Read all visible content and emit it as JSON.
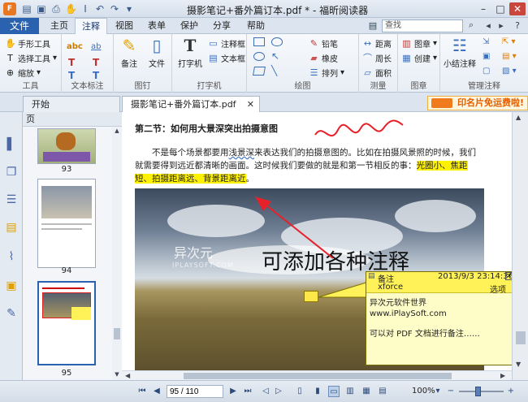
{
  "window": {
    "title": "摄影笔记+番外篇订本.pdf * - 福昕阅读器",
    "minimize": "–",
    "maximize": "□",
    "close": "✕"
  },
  "menu": {
    "file": "文件",
    "tabs": [
      "主页",
      "注释",
      "视图",
      "表单",
      "保护",
      "分享",
      "帮助"
    ],
    "active_tab": "注释",
    "search_placeholder": "查找"
  },
  "ribbon": {
    "tools": {
      "items": [
        "手形工具",
        "选择工具",
        "缩放"
      ],
      "label": "工具"
    },
    "text_markup": {
      "label": "文本标注",
      "glyphs": [
        "abc",
        "ab",
        "T",
        "T",
        "T",
        "T"
      ]
    },
    "stamp_area": {
      "note": "备注",
      "file": "文件",
      "label": "图钉"
    },
    "typewriter": {
      "big": "打字机",
      "items": [
        "注释框",
        "文本框"
      ],
      "label": "打字机"
    },
    "drawing": {
      "items": [
        "铅笔",
        "橡皮",
        "排列"
      ],
      "label": "绘图"
    },
    "measure": {
      "items": [
        "距离",
        "周长",
        "面积"
      ],
      "label": "测量"
    },
    "image": {
      "items": [
        "图章",
        "创建"
      ],
      "label": "图章"
    },
    "manage": {
      "big": "小结注释",
      "label": "管理注释"
    }
  },
  "doc_tabs": {
    "start": "开始",
    "current": "摄影笔记+番外篇订本.pdf",
    "promo": "印名片免运费啦!"
  },
  "thumb_panel": {
    "header": "页",
    "pages": [
      "93",
      "94",
      "95"
    ]
  },
  "document": {
    "section_title": "第二节：如何用大景深突出拍摄意图",
    "para_start": "不是每个场景都要用",
    "para_underlined": "浅景深",
    "para_mid": "来表达我们的拍摄意图的。比如在拍摄风景照的时候，我们就需要得到远近都清晰的画面。这时候我们要做的就是和第一节相反的事：",
    "para_highlight": "光圈小、焦距短、拍摄距离远、背景距离近",
    "para_end": "。",
    "watermark": "异次元",
    "watermark_sub": "IPLAYSOFT.COM",
    "caption": "可添加各种注释"
  },
  "note_popup": {
    "type": "备注",
    "datetime": "2013/9/3 23:14:36",
    "author": "xforce",
    "options": "选项",
    "line1": "异次元软件世界",
    "line2": "www.iPlaySoft.com",
    "line3": "可以对 PDF 文档进行备注……"
  },
  "status": {
    "page_input": "95 / 110",
    "zoom": "100%"
  },
  "colors": {
    "accent": "#2b62b0",
    "highlight": "#fff200",
    "note_yellow": "#fff259",
    "promo_orange": "#e25f00",
    "ink_red": "#e8202a"
  }
}
